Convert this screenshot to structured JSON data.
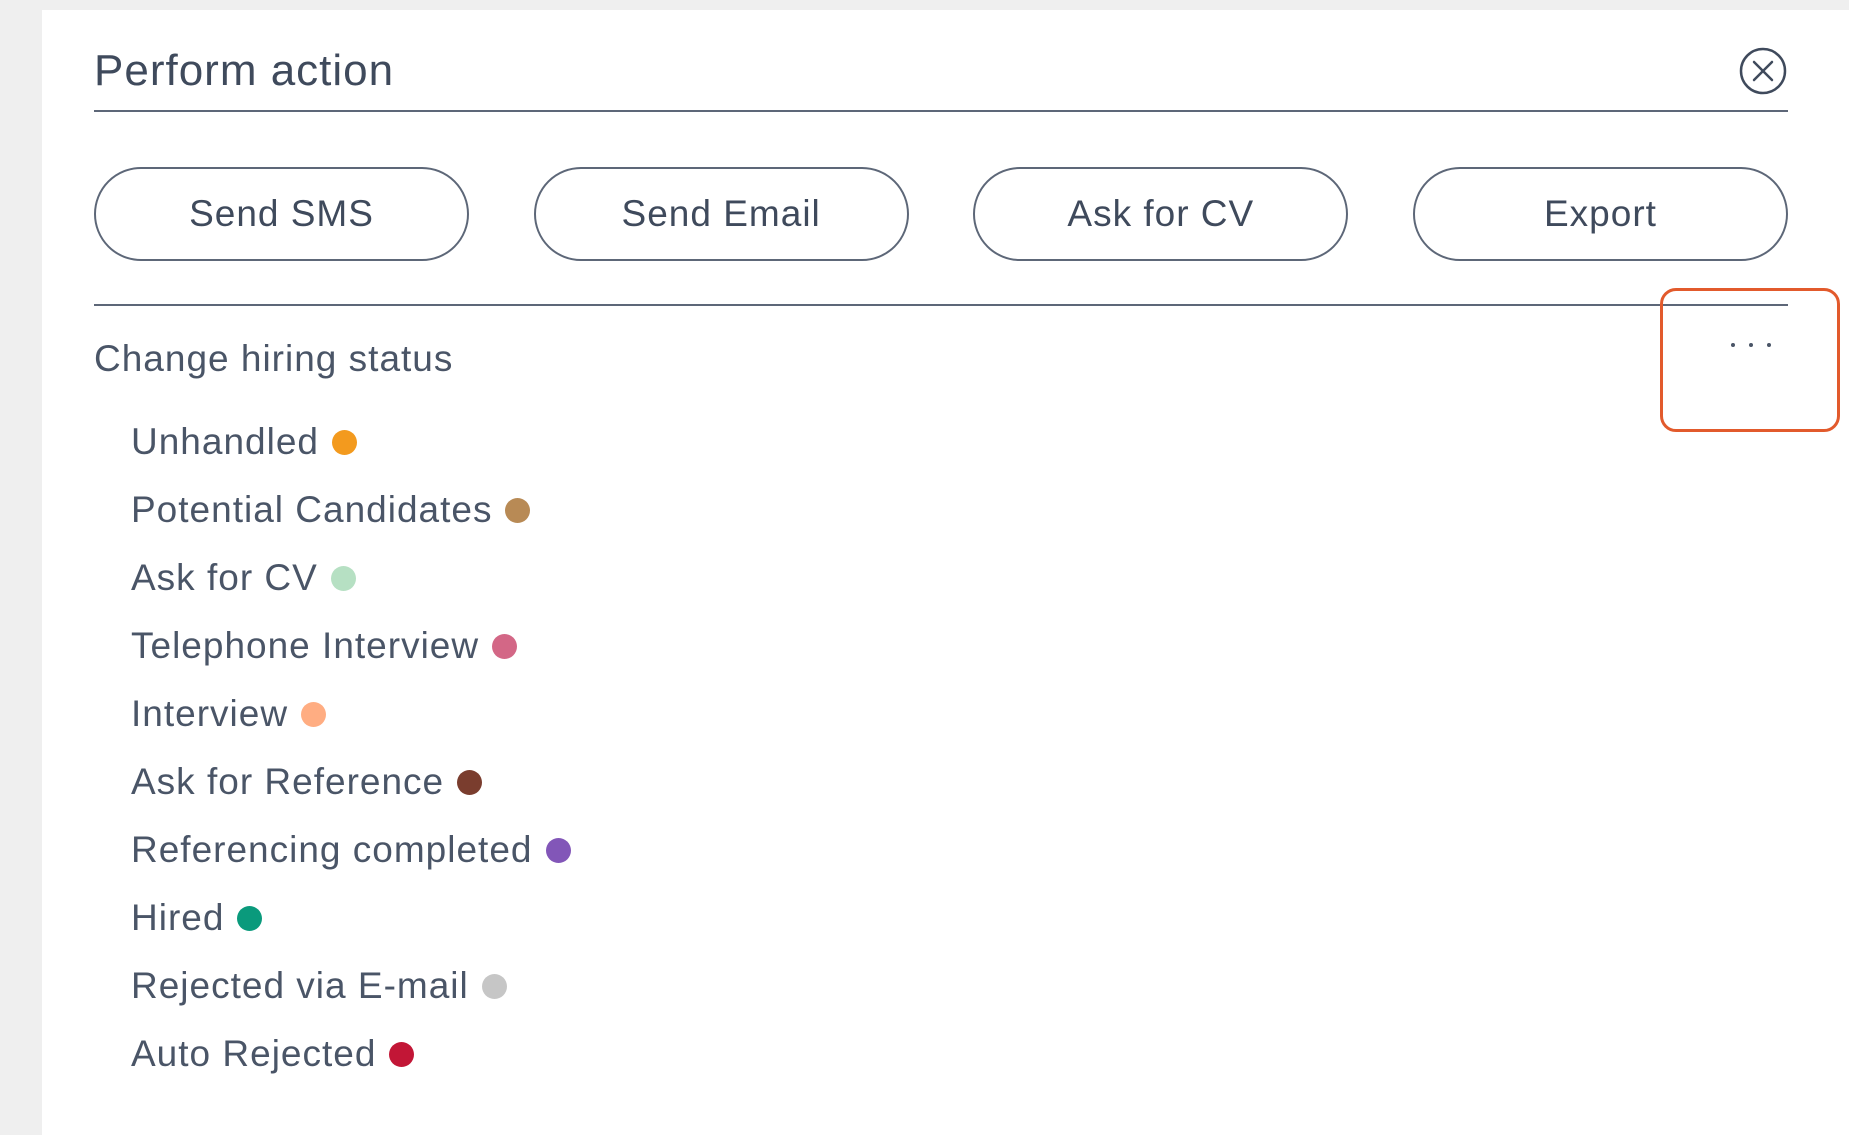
{
  "header": {
    "title": "Perform action",
    "close_icon": "close-circle-icon"
  },
  "actions": [
    {
      "label": "Send SMS",
      "name": "send-sms-button"
    },
    {
      "label": "Send Email",
      "name": "send-email-button"
    },
    {
      "label": "Ask for CV",
      "name": "ask-for-cv-button"
    },
    {
      "label": "Export",
      "name": "export-button"
    }
  ],
  "hiring_status": {
    "title": "Change hiring status",
    "more_icon": "more-horizontal-icon",
    "highlight_color": "#e25a2c",
    "items": [
      {
        "label": "Unhandled",
        "color": "#f39a1e"
      },
      {
        "label": "Potential Candidates",
        "color": "#b88a55"
      },
      {
        "label": "Ask for CV",
        "color": "#b6e0c3"
      },
      {
        "label": "Telephone Interview",
        "color": "#d36786"
      },
      {
        "label": "Interview",
        "color": "#ffad82"
      },
      {
        "label": "Ask for Reference",
        "color": "#7a3d2e"
      },
      {
        "label": "Referencing completed",
        "color": "#8256b8"
      },
      {
        "label": "Hired",
        "color": "#0a9a7c"
      },
      {
        "label": "Rejected via E-mail",
        "color": "#c6c6c6"
      },
      {
        "label": "Auto Rejected",
        "color": "#c21636"
      }
    ]
  }
}
